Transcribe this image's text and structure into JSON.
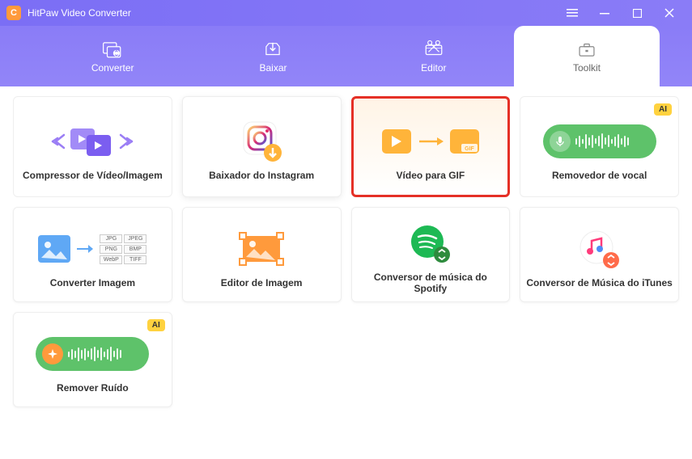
{
  "app": {
    "title": "HitPaw Video Converter"
  },
  "nav": {
    "items": [
      {
        "label": "Converter"
      },
      {
        "label": "Baixar"
      },
      {
        "label": "Editor"
      },
      {
        "label": "Toolkit"
      }
    ]
  },
  "toolkit": {
    "cards": [
      {
        "label": "Compressor de Vídeo/Imagem",
        "ai": false
      },
      {
        "label": "Baixador do Instagram",
        "ai": false
      },
      {
        "label": "Vídeo para GIF",
        "ai": false
      },
      {
        "label": "Removedor de vocal",
        "ai": true
      },
      {
        "label": "Converter Imagem",
        "ai": false
      },
      {
        "label": "Editor de Imagem",
        "ai": false
      },
      {
        "label": "Conversor de música do Spotify",
        "ai": false
      },
      {
        "label": "Conversor de Música do iTunes",
        "ai": false
      },
      {
        "label": "Remover Ruído",
        "ai": true
      }
    ],
    "ai_badge": "AI",
    "image_formats": [
      "JPG",
      "JPEG",
      "PNG",
      "BMP",
      "WebP",
      "TIFF"
    ]
  }
}
